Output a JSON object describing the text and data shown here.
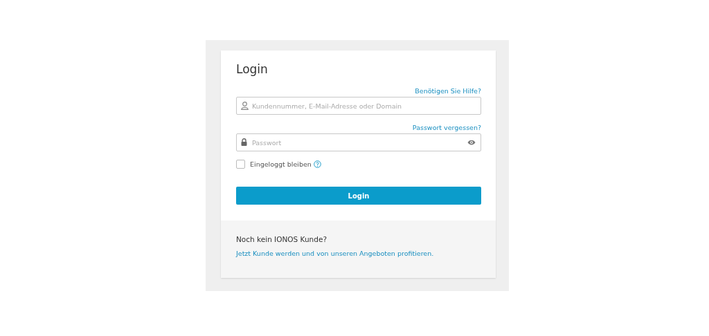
{
  "title": "Login",
  "help_link": "Benötigen Sie Hilfe?",
  "username_field": {
    "placeholder": "Kundennummer, E-Mail-Adresse oder Domain"
  },
  "forgot_link": "Passwort vergessen?",
  "password_field": {
    "placeholder": "Passwort"
  },
  "remember": {
    "label": "Eingeloggt bleiben",
    "checked": false
  },
  "login_button": "Login",
  "footer": {
    "heading": "Noch kein IONOS Kunde?",
    "link": "Jetzt Kunde werden und von unseren Angeboten profitieren."
  }
}
